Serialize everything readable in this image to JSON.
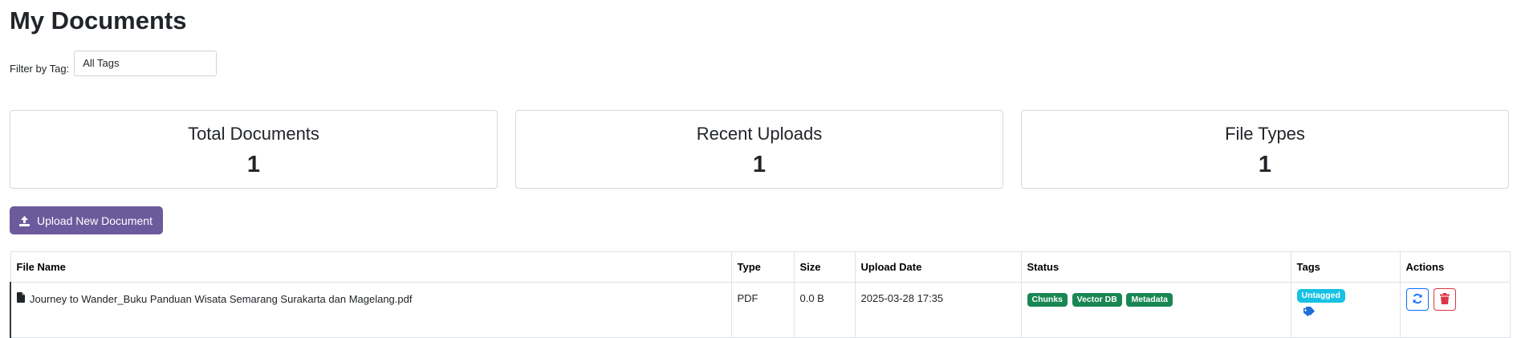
{
  "page": {
    "title": "My Documents"
  },
  "filter": {
    "label": "Filter by Tag:",
    "selected": "All Tags"
  },
  "stats": [
    {
      "title": "Total Documents",
      "value": "1"
    },
    {
      "title": "Recent Uploads",
      "value": "1"
    },
    {
      "title": "File Types",
      "value": "1"
    }
  ],
  "upload": {
    "label": "Upload New Document",
    "icon": "upload-icon"
  },
  "table": {
    "headers": [
      "File Name",
      "Type",
      "Size",
      "Upload Date",
      "Status",
      "Tags",
      "Actions"
    ],
    "rows": [
      {
        "file_name": "Journey to Wander_Buku Panduan Wisata Semarang Surakarta dan Magelang.pdf",
        "type": "PDF",
        "size": "0.0 B",
        "upload_date": "2025-03-28 17:35",
        "status": [
          "Chunks",
          "Vector DB",
          "Metadata"
        ],
        "tag": "Untagged"
      }
    ]
  },
  "colors": {
    "primary_button": "#6c5a9c",
    "status_badge": "#198754",
    "tag_badge": "#17c1e3",
    "refresh_action": "#0d6efd",
    "delete_action": "#dc3545"
  }
}
